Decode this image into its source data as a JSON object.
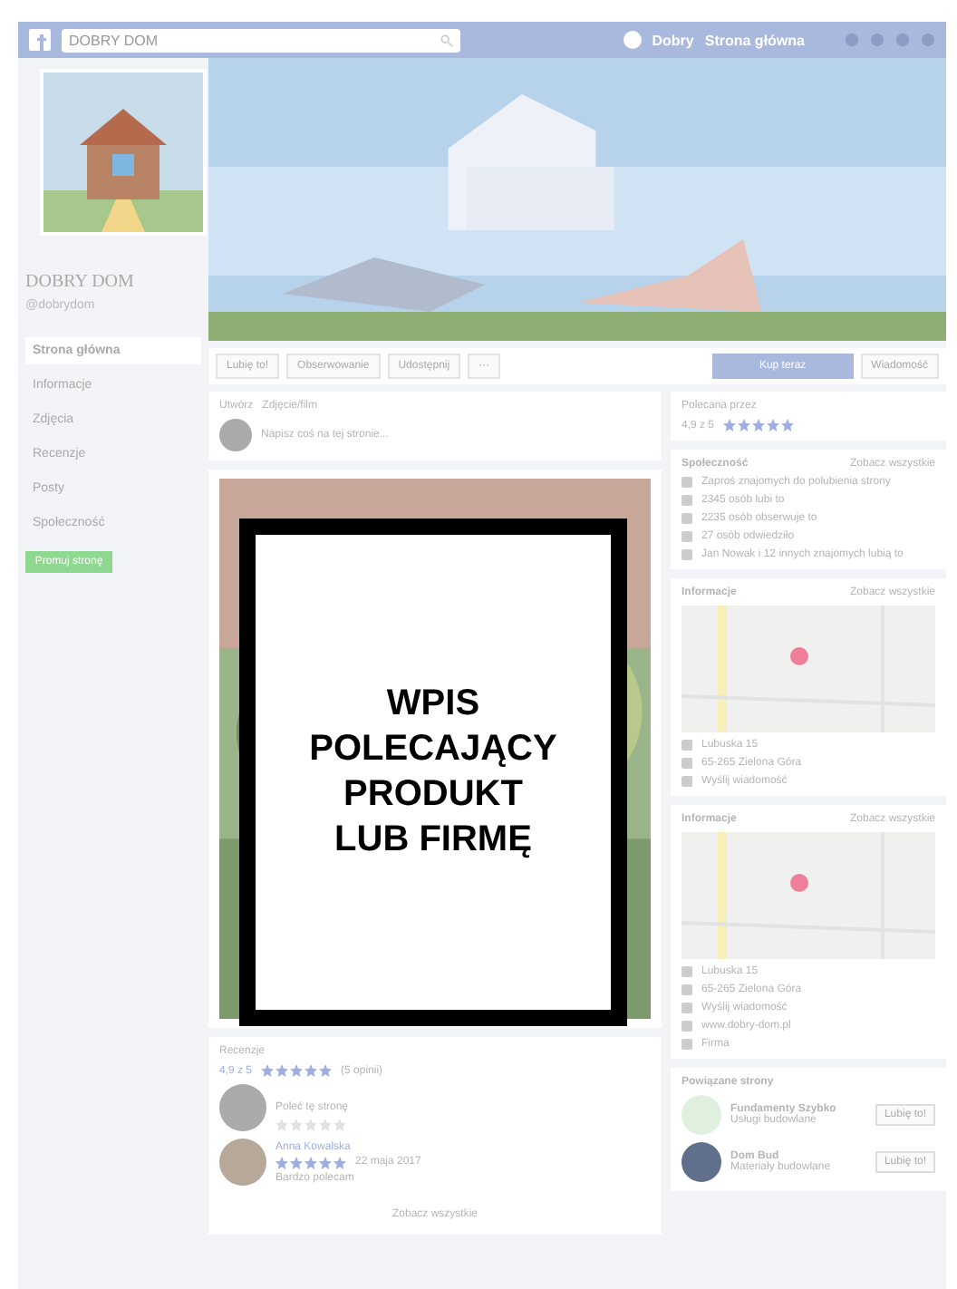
{
  "top_bar": {
    "search_value": "DOBRY DOM",
    "profile_name": "Dobry",
    "home_link": "Strona główna"
  },
  "page": {
    "name": "DOBRY DOM",
    "username": "@dobrydom"
  },
  "nav": [
    {
      "label": "Strona główna",
      "selected": true
    },
    {
      "label": "Informacje",
      "selected": false
    },
    {
      "label": "Zdjęcia",
      "selected": false
    },
    {
      "label": "Recenzje",
      "selected": false
    },
    {
      "label": "Posty",
      "selected": false
    },
    {
      "label": "Społeczność",
      "selected": false
    }
  ],
  "promote_button": "Promuj stronę",
  "actions": [
    "Lubię to!",
    "Obserwowanie",
    "Udostępnij",
    "···"
  ],
  "primary_button": "Kup teraz",
  "message_button": "Wiadomość",
  "composer": {
    "tabs": [
      "Utwórz",
      "Zdjęcie/film"
    ],
    "placeholder": "Napisz coś na tej stronie..."
  },
  "overlay": {
    "lines": [
      "WPIS",
      "POLECAJĄCY",
      "PRODUKT",
      "LUB FIRMĘ"
    ]
  },
  "reviews": {
    "title": "Recenzje",
    "rating": "4,9 z 5",
    "stars": 5,
    "count": "(5 opinii)",
    "prompt": {
      "text": "Poleć tę stronę",
      "stars": 0
    },
    "items": [
      {
        "name": "Anna Kowalska",
        "stars": 5,
        "date": "22 maja 2017",
        "text": "Bardzo polecam"
      }
    ],
    "more": "Zobacz wszystkie"
  },
  "rating_card": {
    "title": "Polecana przez",
    "rating": "4,9 z 5",
    "stars": 5
  },
  "community": {
    "title": "Społeczność",
    "link": "Zobacz wszystkie",
    "items": [
      "Zaproś znajomych do polubienia strony",
      "2345 osób lubi to",
      "2235 osób obserwuje to",
      "27 osób odwiedziło",
      "Jan Nowak i 12 innych znajomych lubią to"
    ]
  },
  "info_cards": [
    {
      "title": "Informacje",
      "link": "Zobacz wszystkie",
      "lines": [
        "Lubuska 15",
        "65-265 Zielona Góra",
        "Wyślij wiadomość"
      ]
    },
    {
      "title": "Informacje",
      "link": "Zobacz wszystkie",
      "lines": [
        "Lubuska 15",
        "65-265 Zielona Góra",
        "Wyślij wiadomość",
        "www.dobry-dom.pl",
        "Firma"
      ]
    }
  ],
  "related": {
    "title": "Powiązane strony",
    "items": [
      {
        "name": "Fundamenty Szybko",
        "sub": "Usługi budowlane",
        "button": "Lubię to!"
      },
      {
        "name": "Dom Bud",
        "sub": "Materiały budowlane",
        "button": "Lubię to!"
      }
    ]
  }
}
